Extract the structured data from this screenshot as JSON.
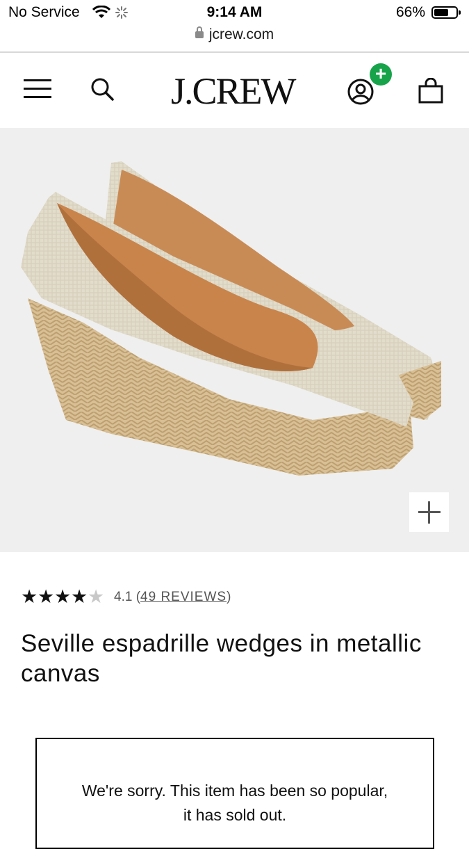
{
  "status_bar": {
    "carrier": "No Service",
    "time": "9:14 AM",
    "battery_pct": "66%",
    "battery_level": 0.66,
    "icons": [
      "wifi-icon",
      "loading-icon",
      "battery-icon"
    ]
  },
  "browser": {
    "url": "jcrew.com",
    "icons": [
      "lock-icon"
    ]
  },
  "header": {
    "logo": "J.CREW",
    "account_badge": "+",
    "icons": [
      "menu-icon",
      "search-icon",
      "account-icon",
      "bag-icon"
    ]
  },
  "product": {
    "image_alt": "Seville espadrille wedges in metallic canvas",
    "zoom_icon": "plus-icon",
    "rating_value": "4.1",
    "rating_stars": 4.1,
    "rating_open": "(",
    "reviews_label": "49 REVIEWS",
    "rating_close": ")",
    "title": "Seville espadrille wedges in metallic canvas",
    "soldout_message": "We're sorry. This item has been so popular, it has sold out."
  },
  "colors": {
    "badge_green": "#17a34a",
    "hero_bg": "#efefef",
    "canvas": "#e2dccb",
    "jute": "#d9bf95"
  }
}
